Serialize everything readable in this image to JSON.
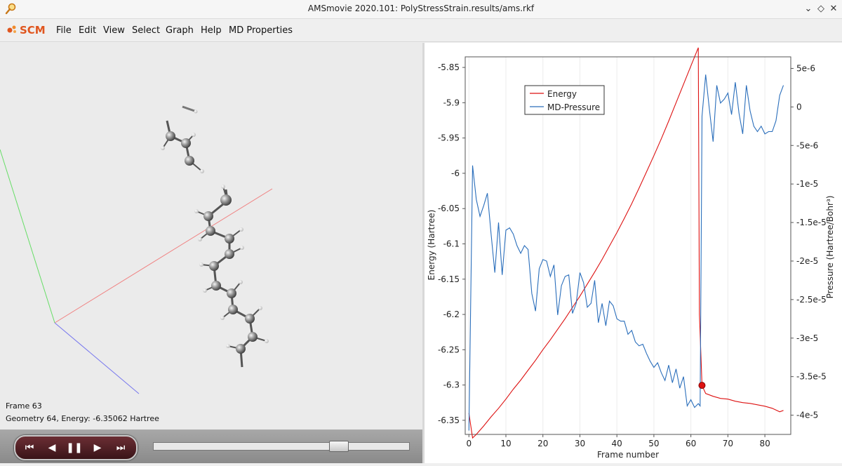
{
  "window": {
    "title": "AMSmovie 2020.101: PolyStressStrain.results/ams.rkf",
    "icons": [
      "magnifier-app-icon",
      "chevron-down-icon",
      "restore-icon",
      "close-icon"
    ]
  },
  "menu": {
    "logo": "SCM",
    "items": [
      "File",
      "Edit",
      "View",
      "Select",
      "Graph",
      "Help",
      "MD Properties"
    ]
  },
  "viewer": {
    "frame_label": "Frame 63",
    "geometry_label": "Geometry 64, Energy: -6.35062 Hartree"
  },
  "player": {
    "buttons": [
      "first-frame",
      "previous-frame",
      "pause",
      "next-frame",
      "last-frame"
    ],
    "slider_fraction": 0.74
  },
  "colors": {
    "energy": "#dd1111",
    "pressure": "#2a6ebb",
    "axis_x_red": "#f08080",
    "axis_y_green": "#66dd66",
    "axis_z_blue": "#7777ee"
  },
  "chart_data": {
    "type": "line",
    "xlabel": "Frame number",
    "ylabel": "Energy (Hartree)",
    "y2label": "Pressure (Hartree/Bohr³)",
    "xlim": [
      -1,
      87
    ],
    "ylim": [
      -6.37,
      -5.835
    ],
    "y2lim": [
      -4.25e-05,
      6.5e-06
    ],
    "xticks": [
      "0",
      "10",
      "20",
      "30",
      "40",
      "50",
      "60",
      "70",
      "80"
    ],
    "xtick_values": [
      0,
      10,
      20,
      30,
      40,
      50,
      60,
      70,
      80
    ],
    "yticks": [
      "-5.85",
      "-5.9",
      "-5.95",
      "-6",
      "-6.05",
      "-6.1",
      "-6.15",
      "-6.2",
      "-6.25",
      "-6.3",
      "-6.35"
    ],
    "ytick_values": [
      -5.85,
      -5.9,
      -5.95,
      -6.0,
      -6.05,
      -6.1,
      -6.15,
      -6.2,
      -6.25,
      -6.3,
      -6.35
    ],
    "y2ticks": [
      "5e-6",
      "0",
      "-5e-6",
      "-1e-5",
      "-1.5e-5",
      "-2e-5",
      "-2.5e-5",
      "-3e-5",
      "-3.5e-5",
      "-4e-5"
    ],
    "y2tick_values": [
      5e-06,
      0,
      -5e-06,
      -1e-05,
      -1.5e-05,
      -2e-05,
      -2.5e-05,
      -3e-05,
      -3.5e-05,
      -4e-05
    ],
    "legend": "top-left",
    "marker": {
      "x": 63,
      "y": -6.3005
    },
    "series": [
      {
        "name": "Energy",
        "axis": "left",
        "x": [
          0,
          1,
          2,
          4,
          6,
          8,
          10,
          12,
          14,
          16,
          18,
          20,
          22,
          24,
          26,
          28,
          30,
          32,
          34,
          36,
          38,
          40,
          42,
          44,
          46,
          48,
          50,
          52,
          54,
          56,
          58,
          60,
          62,
          62.3,
          63,
          64,
          66,
          68,
          70,
          72,
          74,
          76,
          78,
          80,
          82,
          84,
          85
        ],
        "y": [
          -6.34,
          -6.375,
          -6.37,
          -6.358,
          -6.345,
          -6.333,
          -6.32,
          -6.306,
          -6.293,
          -6.279,
          -6.265,
          -6.25,
          -6.236,
          -6.221,
          -6.206,
          -6.19,
          -6.174,
          -6.157,
          -6.14,
          -6.122,
          -6.103,
          -6.084,
          -6.064,
          -6.043,
          -6.021,
          -5.998,
          -5.975,
          -5.951,
          -5.926,
          -5.9,
          -5.874,
          -5.848,
          -5.822,
          -6.2,
          -6.3005,
          -6.312,
          -6.316,
          -6.319,
          -6.32,
          -6.323,
          -6.325,
          -6.326,
          -6.328,
          -6.33,
          -6.333,
          -6.338,
          -6.336
        ]
      },
      {
        "name": "MD-Pressure",
        "axis": "right",
        "x": [
          0,
          1,
          2,
          3,
          4,
          5,
          6,
          7,
          8,
          9,
          10,
          11,
          12,
          13,
          14,
          15,
          16,
          17,
          18,
          19,
          20,
          21,
          22,
          23,
          24,
          25,
          26,
          27,
          28,
          29,
          30,
          31,
          32,
          33,
          34,
          35,
          36,
          37,
          38,
          39,
          40,
          41,
          42,
          43,
          44,
          45,
          46,
          47,
          48,
          49,
          50,
          51,
          52,
          53,
          54,
          55,
          56,
          57,
          58,
          59,
          60,
          61,
          62,
          62.5,
          63,
          64,
          65,
          66,
          67,
          68,
          69,
          70,
          71,
          72,
          73,
          74,
          75,
          76,
          77,
          78,
          79,
          80,
          81,
          82,
          83,
          84,
          85
        ],
        "y": [
          -4.2e-05,
          -7.6e-06,
          -1.2e-05,
          -1.42e-05,
          -1.28e-05,
          -1.12e-05,
          -1.65e-05,
          -2.15e-05,
          -1.5e-05,
          -2.18e-05,
          -1.6e-05,
          -1.57e-05,
          -1.65e-05,
          -1.8e-05,
          -1.9e-05,
          -1.8e-05,
          -1.85e-05,
          -2.42e-05,
          -2.65e-05,
          -2.1e-05,
          -1.98e-05,
          -2e-05,
          -2.2e-05,
          -2.05e-05,
          -2.7e-05,
          -2.32e-05,
          -2.2e-05,
          -2.18e-05,
          -2.68e-05,
          -2.55e-05,
          -2.15e-05,
          -2.28e-05,
          -2.6e-05,
          -2.55e-05,
          -2.25e-05,
          -2.8e-05,
          -2.55e-05,
          -2.84e-05,
          -2.52e-05,
          -2.58e-05,
          -2.75e-05,
          -2.78e-05,
          -2.78e-05,
          -2.95e-05,
          -2.9e-05,
          -3.05e-05,
          -3.1e-05,
          -3.08e-05,
          -3.2e-05,
          -3.3e-05,
          -3.38e-05,
          -3.32e-05,
          -3.45e-05,
          -3.55e-05,
          -3.35e-05,
          -3.58e-05,
          -3.4e-05,
          -3.65e-05,
          -3.5e-05,
          -3.88e-05,
          -3.8e-05,
          -3.9e-05,
          -3.85e-05,
          -3.88e-05,
          -1.2e-06,
          4.2e-06,
          -3e-07,
          -4.5e-06,
          2.8e-06,
          5e-07,
          1e-06,
          1.8e-06,
          -1e-06,
          3.2e-06,
          -8e-07,
          -3.5e-06,
          2.8e-06,
          -5e-07,
          -2.5e-06,
          -3.2e-06,
          -2.5e-06,
          -3.5e-06,
          -3.2e-06,
          -3.2e-06,
          -1.8e-06,
          1.5e-06,
          2.8e-06
        ]
      }
    ]
  }
}
